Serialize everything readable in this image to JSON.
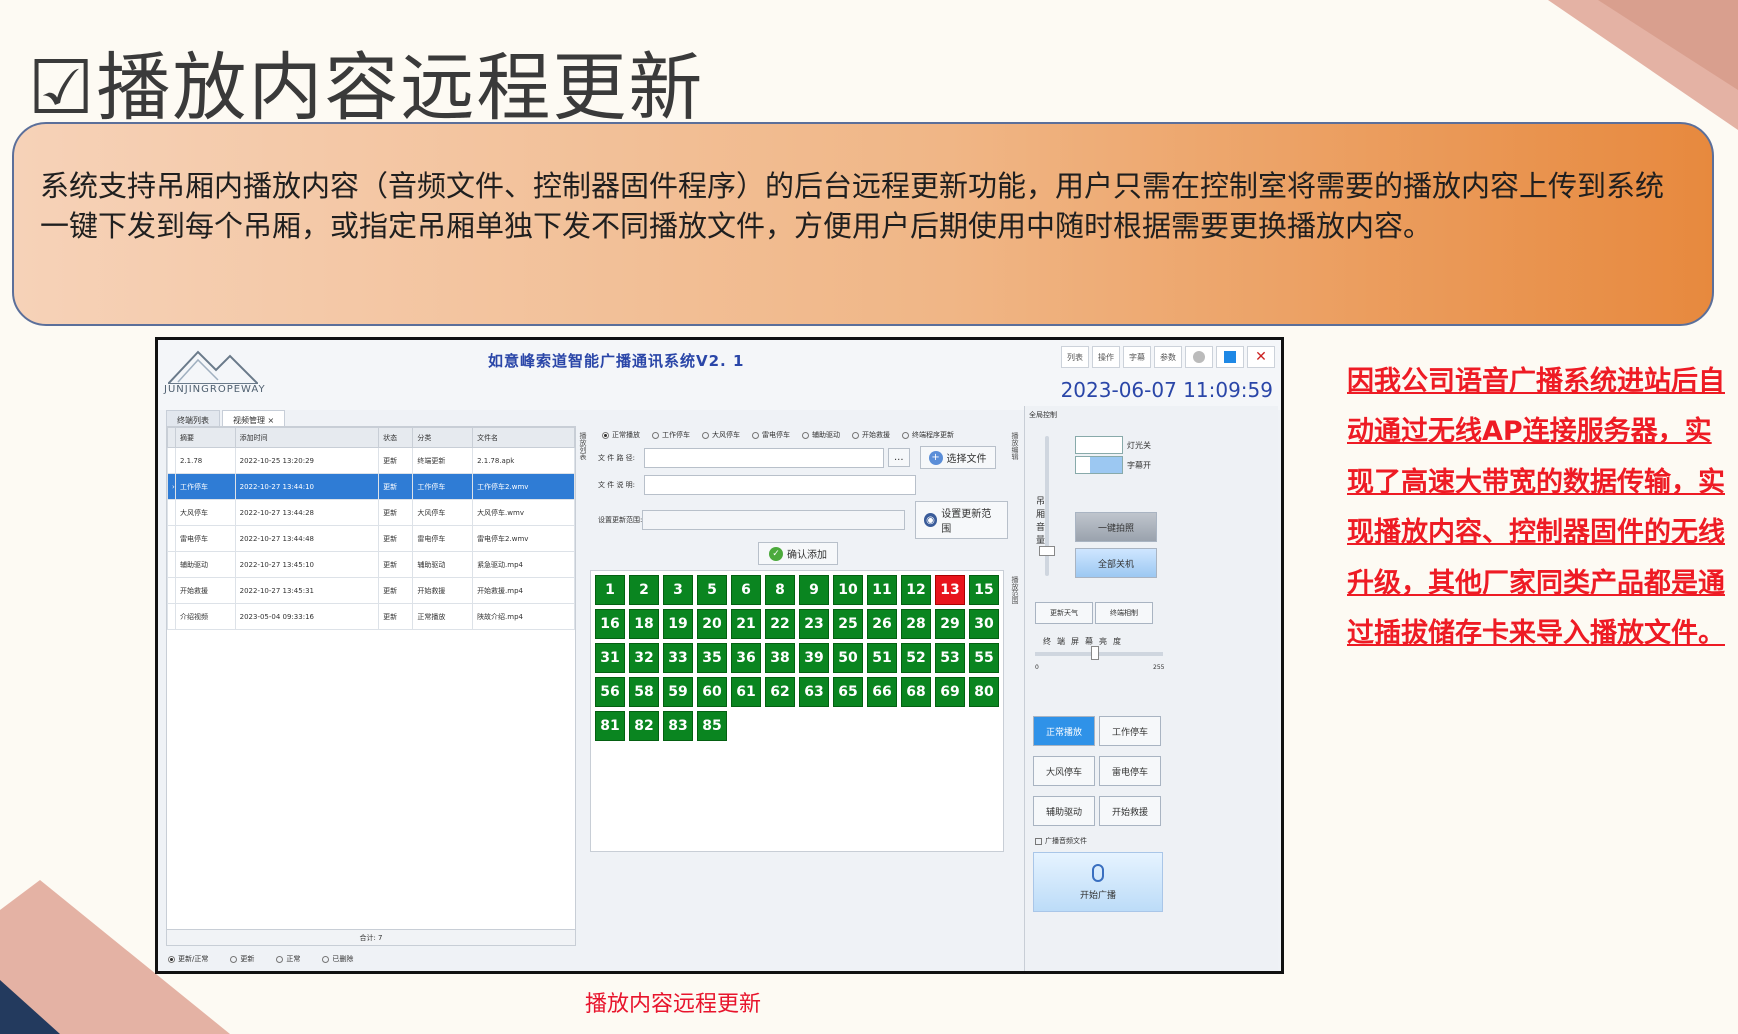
{
  "page": {
    "title": "☑播放内容远程更新",
    "description": "系统支持吊厢内播放内容（音频文件、控制器固件程序）的后台远程更新功能，用户只需在控制室将需要的播放内容上传到系统一键下发到每个吊厢，或指定吊厢单独下发不同播放文件，方便用户后期使用中随时根据需要更换播放内容。",
    "caption": "播放内容远程更新",
    "side_note": "因我公司语音广播系统进站后自动通过无线AP连接服务器，实现了高速大带宽的数据传输，实现播放内容、控制器固件的无线升级，其他厂家同类产品都是通过插拔储存卡来导入播放文件。"
  },
  "colors": {
    "accent_blue": "#2a46a8",
    "cabin_green": "#0a8520",
    "cabin_alert": "#e8141c",
    "note_red": "#ee1b24",
    "box_orange": "#e7893e"
  },
  "app": {
    "logo_text": "JUNJINGROPEWAY",
    "title": "如意峰索道智能广播通讯系统V2. 1",
    "window_buttons": [
      "列表",
      "操作",
      "字幕",
      "参数"
    ],
    "clock": "2023-06-07 11:09:59",
    "tabs": [
      "终端列表",
      "视频管理 ×"
    ],
    "table": {
      "headers": [
        "摘要",
        "添加时间",
        "状态",
        "分类",
        "文件名"
      ],
      "rows": [
        [
          "2.1.78",
          "2022-10-25 13:20:29",
          "更新",
          "终端更新",
          "2.1.78.apk"
        ],
        [
          "工作停车",
          "2022-10-27 13:44:10",
          "更新",
          "工作停车",
          "工作停车2.wmv"
        ],
        [
          "大风停车",
          "2022-10-27 13:44:28",
          "更新",
          "大风停车",
          "大风停车.wmv"
        ],
        [
          "雷电停车",
          "2022-10-27 13:44:48",
          "更新",
          "雷电停车",
          "雷电停车2.wmv"
        ],
        [
          "辅助驱动",
          "2022-10-27 13:45:10",
          "更新",
          "辅助驱动",
          "紧急驱动.mp4"
        ],
        [
          "开始救援",
          "2022-10-27 13:45:31",
          "更新",
          "开始救援",
          "开始救援.mp4"
        ],
        [
          "介绍视频",
          "2023-05-04 09:33:16",
          "更新",
          "正常播放",
          "陕故介绍.mp4"
        ]
      ],
      "footer": "合计: 7"
    },
    "filters": [
      "更新/正常",
      "更新",
      "正常",
      "已删除"
    ],
    "modes": [
      "正常播放",
      "工作停车",
      "大风停车",
      "雷电停车",
      "辅助驱动",
      "开始救援",
      "终端程序更新"
    ],
    "form": {
      "path_label": "文 件 路 径:",
      "desc_label": "文 件 说 明:",
      "range_label": "设置更新范围:",
      "select_file": "选择文件",
      "set_range": "设置更新范围",
      "confirm": "确认添加",
      "browse": "..."
    },
    "section_labels": [
      "播放列表",
      "播放编辑",
      "播放范围"
    ],
    "cabins": [
      "1",
      "2",
      "3",
      "5",
      "6",
      "8",
      "9",
      "10",
      "11",
      "12",
      "13",
      "15",
      "16",
      "18",
      "19",
      "20",
      "21",
      "22",
      "23",
      "25",
      "26",
      "28",
      "29",
      "30",
      "31",
      "32",
      "33",
      "35",
      "36",
      "38",
      "39",
      "50",
      "51",
      "52",
      "53",
      "55",
      "56",
      "58",
      "59",
      "60",
      "61",
      "62",
      "63",
      "65",
      "66",
      "68",
      "69",
      "80",
      "81",
      "82",
      "83",
      "85"
    ],
    "alert_cabin": "13",
    "control": {
      "title": "全局控制",
      "volume_label": "吊厢音量",
      "toggle_light": "灯光关",
      "toggle_caption": "字幕开",
      "photo_btn": "一键拍照",
      "all_off_btn": "全部关机",
      "weather_btn": "更新天气",
      "terminal_btn": "终端相制",
      "brightness_label": "终端屏幕亮度",
      "bright_min": "0",
      "bright_max": "255",
      "mode_buttons": [
        "正常播放",
        "工作停车",
        "大风停车",
        "雷电停车",
        "辅助驱动",
        "开始救援"
      ],
      "broadcast_check": "广播音频文件",
      "broadcast_btn": "开始广播"
    }
  }
}
